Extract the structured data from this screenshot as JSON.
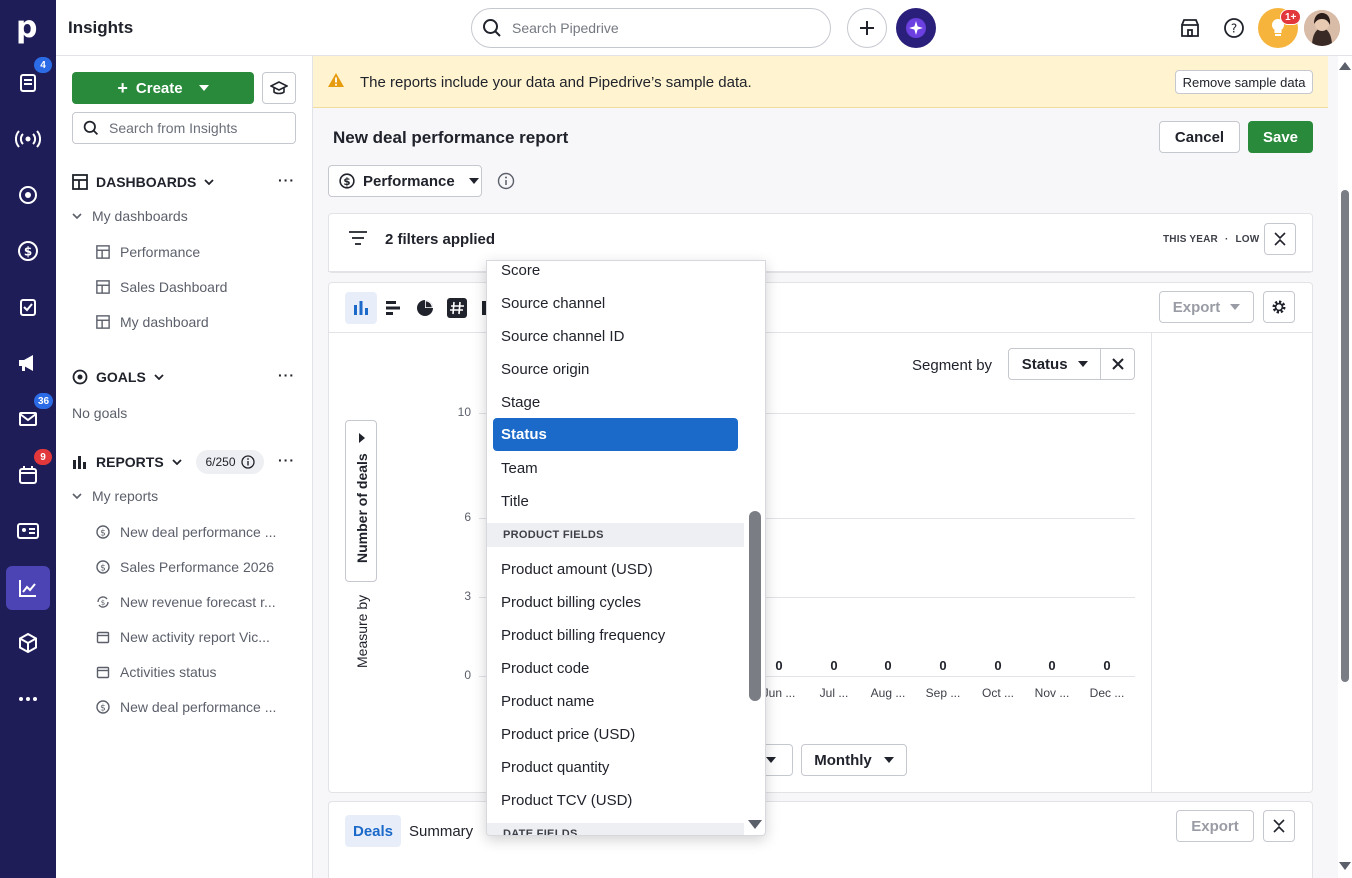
{
  "app": {
    "title": "Insights"
  },
  "topbar": {
    "search_placeholder": "Search Pipedrive",
    "notification_badge": "1+"
  },
  "rail": {
    "badges": {
      "leads": "4",
      "mail": "36",
      "activities": "9"
    },
    "icons": [
      "leads-icon",
      "campaigns-icon",
      "projects-icon",
      "deals-icon",
      "tasks-icon",
      "marketing-icon",
      "mail-icon",
      "calendar-icon",
      "contacts-icon",
      "insights-icon",
      "products-icon",
      "more-icon"
    ]
  },
  "sidebar": {
    "create_label": "Create",
    "search_placeholder": "Search from Insights",
    "dashboards": {
      "title": "DASHBOARDS",
      "group": "My dashboards",
      "items": [
        "Performance",
        "Sales Dashboard",
        "My dashboard"
      ]
    },
    "goals": {
      "title": "GOALS",
      "empty": "No goals"
    },
    "reports": {
      "title": "REPORTS",
      "count": "6/250",
      "group": "My reports",
      "items": [
        "New deal performance ...",
        "Sales Performance 2026",
        "New revenue forecast r...",
        "New activity report Vic...",
        "Activities status",
        "New deal performance ..."
      ]
    }
  },
  "banner": {
    "text": "The reports include your data and Pipedrive’s sample data.",
    "remove_label": "Remove sample data"
  },
  "report": {
    "title": "New deal performance report",
    "cancel_label": "Cancel",
    "save_label": "Save",
    "type_label": "Performance"
  },
  "filters": {
    "text": "2 filters applied",
    "period": "THIS YEAR",
    "separator": "·",
    "level": "LOW"
  },
  "chart": {
    "export_label": "Export",
    "segment_label": "Segment by",
    "segment_value": "Status",
    "measure_label": "Measure by",
    "measure_value": "Number of deals",
    "interval_value": "Monthly"
  },
  "chart_data": {
    "type": "bar",
    "categories": [
      "Jun ...",
      "Jul ...",
      "Aug ...",
      "Sep ...",
      "Oct ...",
      "Nov ...",
      "Dec ..."
    ],
    "values": [
      0,
      0,
      0,
      0,
      0,
      0,
      0
    ],
    "data_labels": [
      "0",
      "0",
      "0",
      "0",
      "0",
      "0",
      "0"
    ],
    "y_ticks": [
      "10",
      "6",
      "3",
      "0"
    ],
    "ylim": [
      0,
      10
    ],
    "ylabel": "Number of deals",
    "grid": true
  },
  "table": {
    "tabs": [
      "Deals",
      "Summary"
    ],
    "export_label": "Export"
  },
  "dropdown": {
    "items_top": [
      "Score",
      "Source channel",
      "Source channel ID",
      "Source origin",
      "Stage",
      "Status",
      "Team",
      "Title"
    ],
    "selected": "Status",
    "product_header": "PRODUCT FIELDS",
    "product_items": [
      "Product amount (USD)",
      "Product billing cycles",
      "Product billing frequency",
      "Product code",
      "Product name",
      "Product price (USD)",
      "Product quantity",
      "Product TCV (USD)"
    ],
    "date_header": "DATE FIELDS"
  },
  "colors": {
    "rail": "#1f1d57",
    "accent_green": "#2a8a3c",
    "accent_blue": "#1b6ac9",
    "banner": "#fff4cf",
    "badge_blue": "#2b6be5",
    "badge_red": "#e2383b"
  }
}
